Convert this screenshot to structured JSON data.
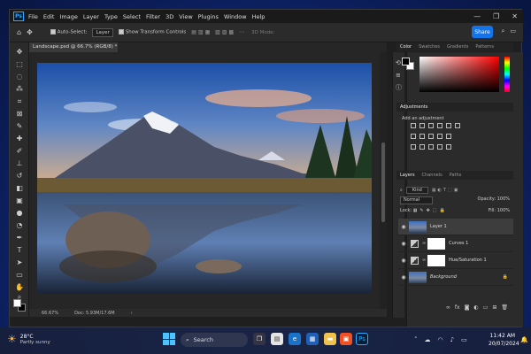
{
  "app": {
    "menu": [
      "File",
      "Edit",
      "Image",
      "Layer",
      "Type",
      "Select",
      "Filter",
      "3D",
      "View",
      "Plugins",
      "Window",
      "Help"
    ],
    "logo": "Ps",
    "window_controls": [
      "—",
      "❐",
      "✕"
    ]
  },
  "options_bar": {
    "auto_select_label": "Auto-Select:",
    "auto_select_value": "Layer",
    "transform_label": "Show Transform Controls",
    "mode_label": "3D Mode:",
    "share_label": "Share"
  },
  "document": {
    "tab_title": "Landscape.psd @ 66.7% (RGB/8) *",
    "zoom": "66.67%",
    "doc_info": "Doc: 5.93M/17.6M"
  },
  "panels": {
    "color_tabs": [
      "Color",
      "Swatches",
      "Gradients",
      "Patterns"
    ],
    "adjustments_title": "Adjustments",
    "add_adjustment": "Add an adjustment",
    "layers_tabs": [
      "Layers",
      "Channels",
      "Paths"
    ],
    "kind": "Kind",
    "blend_mode": "Normal",
    "opacity_label": "Opacity:",
    "opacity_value": "100%",
    "lock_label": "Lock:",
    "fill_label": "Fill:",
    "fill_value": "100%",
    "layers": [
      "Layer 1",
      "Curves 1",
      "Hue/Saturation 1",
      "Background"
    ]
  },
  "taskbar": {
    "temperature": "28°C",
    "weather": "Partly sunny",
    "search_label": "Search",
    "time": "11:42 AM",
    "date": "20/07/2024"
  }
}
